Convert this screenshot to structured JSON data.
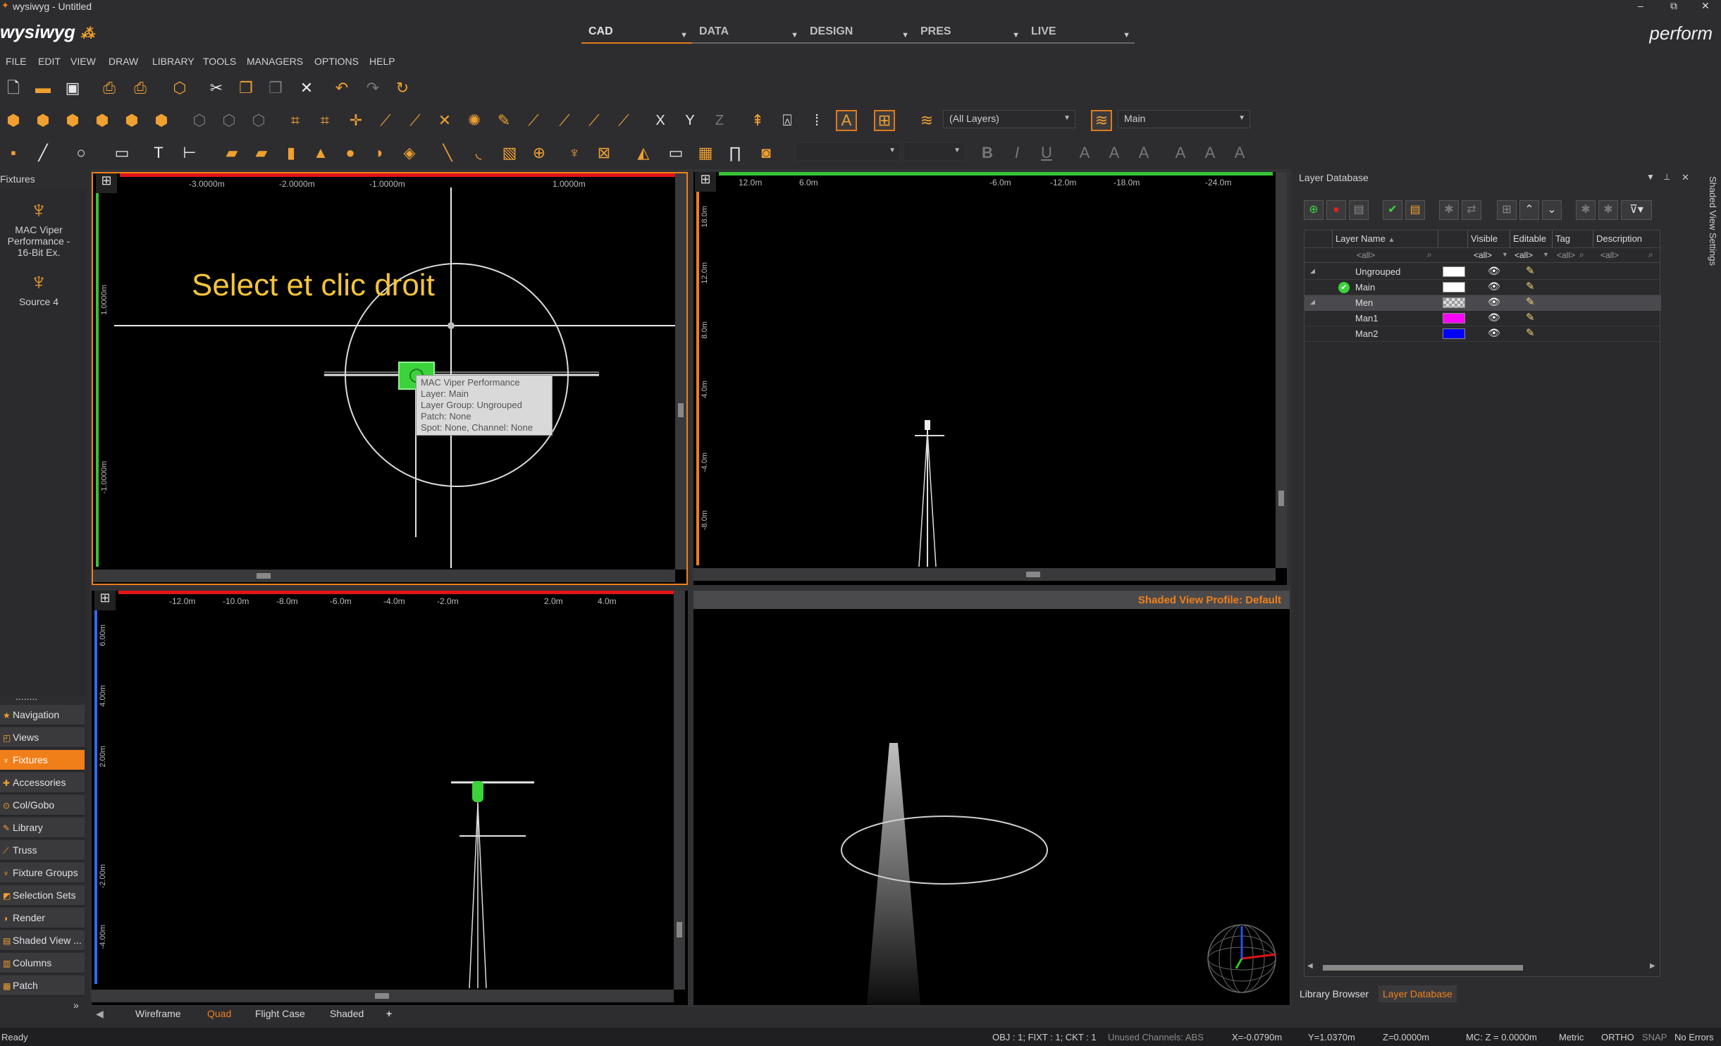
{
  "window": {
    "title": "wysiwyg - Untitled",
    "min": "–",
    "max": "⧉",
    "close": "✕"
  },
  "brand": {
    "logo": "wysiwyg",
    "product": "perform"
  },
  "modes": [
    {
      "label": "CAD"
    },
    {
      "label": "DATA"
    },
    {
      "label": "DESIGN"
    },
    {
      "label": "PRES"
    },
    {
      "label": "LIVE"
    }
  ],
  "menu": [
    "FILE",
    "EDIT",
    "VIEW",
    "DRAW",
    "LIBRARY",
    "TOOLS",
    "MANAGERS",
    "OPTIONS",
    "HELP"
  ],
  "toolbar": {
    "layer_filter": "(All Layers)",
    "current_layer": "Main",
    "axis_x": "X",
    "axis_y": "Y",
    "axis_z": "Z",
    "bold": "B",
    "italic": "I",
    "underline": "U"
  },
  "left_panel": {
    "title": "Fixtures",
    "fixtures": [
      {
        "name": "MAC Viper Performance - 16-Bit Ex."
      },
      {
        "name": "Source 4"
      }
    ],
    "dots": "........",
    "nav": [
      {
        "label": "Navigation",
        "active": false
      },
      {
        "label": "Views",
        "active": false
      },
      {
        "label": "Fixtures",
        "active": true
      },
      {
        "label": "Accessories",
        "active": false
      },
      {
        "label": "Col/Gobo",
        "active": false
      },
      {
        "label": "Library",
        "active": false
      },
      {
        "label": "Truss",
        "active": false
      },
      {
        "label": "Fixture Groups",
        "active": false
      },
      {
        "label": "Selection Sets",
        "active": false
      },
      {
        "label": "Render",
        "active": false
      },
      {
        "label": "Shaded View ...",
        "active": false
      },
      {
        "label": "Columns",
        "active": false
      },
      {
        "label": "Patch",
        "active": false
      }
    ],
    "collapse": "»"
  },
  "viewport_top": {
    "ruler_labels": [
      "-3.0000m",
      "-2.0000m",
      "-1.0000m",
      "1.0000m"
    ],
    "vruler_labels": [
      "1.0000m",
      "-1.0000m"
    ],
    "annotation": "Select et clic droit",
    "tooltip": [
      "MAC Viper Performance",
      "Layer: Main",
      "Layer Group: Ungrouped",
      "Patch: None",
      "Spot: None, Channel: None"
    ]
  },
  "viewport_side": {
    "ruler_labels": [
      "12.0m",
      "6.0m",
      "-6.0m",
      "-12.0m",
      "-18.0m",
      "-24.0m"
    ],
    "vruler_labels": [
      "18.0m",
      "12.0m",
      "8.0m",
      "4.0m",
      "-4.0m",
      "-8.0m"
    ]
  },
  "viewport_front": {
    "ruler_labels": [
      "-12.0m",
      "-10.0m",
      "-8.0m",
      "-6.0m",
      "-4.0m",
      "-2.0m",
      "2.0m",
      "4.0m"
    ],
    "vruler_labels": [
      "6.00m",
      "4.00m",
      "2.00m",
      "-2.00m",
      "-4.00m"
    ]
  },
  "viewport_shaded": {
    "profile": "Shaded View Profile: Default"
  },
  "layer_db": {
    "title": "Layer Database",
    "side_tab": "Shaded View Settings",
    "columns": [
      "Layer Name",
      "Visible",
      "Editable",
      "Tag",
      "Description"
    ],
    "filter_all": "<all>",
    "rows": [
      {
        "name": "Ungrouped",
        "color": "#ffffff",
        "current": false,
        "selected": false
      },
      {
        "name": "Main",
        "color": "#ffffff",
        "current": true,
        "selected": false
      },
      {
        "name": "Men",
        "color": "#cccccc",
        "current": false,
        "selected": true
      },
      {
        "name": "Man1",
        "color": "#ff00ff",
        "current": false,
        "selected": false
      },
      {
        "name": "Man2",
        "color": "#0000ff",
        "current": false,
        "selected": false
      }
    ],
    "tabs": [
      {
        "label": "Library Browser",
        "active": false
      },
      {
        "label": "Layer Database",
        "active": true
      }
    ]
  },
  "bottom_tabs": [
    {
      "label": "Wireframe",
      "active": false
    },
    {
      "label": "Quad",
      "active": true
    },
    {
      "label": "Flight Case",
      "active": false
    },
    {
      "label": "Shaded",
      "active": false
    },
    {
      "label": "+",
      "active": false
    }
  ],
  "status": {
    "ready": "Ready",
    "obj": "OBJ : 1; FIXT : 1; CKT : 1",
    "unused": "Unused Channels: ABS",
    "x": "X=-0.0790m",
    "y": "Y=1.0370m",
    "z": "Z=0.0000m",
    "mc": "MC: Z = 0.0000m",
    "metric": "Metric",
    "ortho": "ORTHO",
    "snap": "SNAP",
    "errors": "No Errors"
  },
  "colors": {
    "accent": "#f07f1a",
    "selected_fixture": "#3cd23c",
    "ruler_red": "#e01515",
    "ruler_green": "#35c435"
  }
}
